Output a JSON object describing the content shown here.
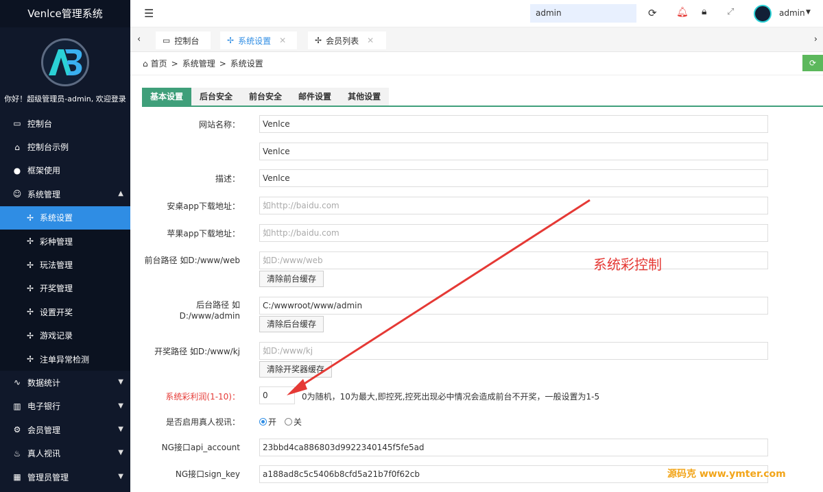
{
  "sidebar": {
    "title": "Venlce管理系统",
    "welcome": "你好！超级管理员-admin, 欢迎登录",
    "items": [
      {
        "label": "控制台",
        "icon": "monitor-icon"
      },
      {
        "label": "控制台示例",
        "icon": "home-icon"
      },
      {
        "label": "框架使用",
        "icon": "ok-icon"
      },
      {
        "label": "系统管理",
        "icon": "user-icon"
      },
      {
        "label": "系统设置",
        "icon": "fan-icon"
      },
      {
        "label": "彩种管理",
        "icon": "fan-icon"
      },
      {
        "label": "玩法管理",
        "icon": "fan-icon"
      },
      {
        "label": "开奖管理",
        "icon": "fan-icon"
      },
      {
        "label": "设置开奖",
        "icon": "fan-icon"
      },
      {
        "label": "游戏记录",
        "icon": "fan-icon"
      },
      {
        "label": "注单异常检测",
        "icon": "fan-icon"
      },
      {
        "label": "数据统计",
        "icon": "chart-icon"
      },
      {
        "label": "电子银行",
        "icon": "bank-icon"
      },
      {
        "label": "会员管理",
        "icon": "gear-icon"
      },
      {
        "label": "真人视讯",
        "icon": "fire-icon"
      },
      {
        "label": "管理员管理",
        "icon": "grid-icon"
      }
    ]
  },
  "topbar": {
    "search_value": "admin",
    "user_name": "admin"
  },
  "tabs": [
    {
      "label": "控制台",
      "icon": "monitor-icon"
    },
    {
      "label": "系统设置",
      "icon": "fan-icon",
      "active": true
    },
    {
      "label": "会员列表",
      "icon": "fan-icon"
    }
  ],
  "breadcrumb": [
    "首页",
    "系统管理",
    "系统设置"
  ],
  "settings_tabs": [
    "基本设置",
    "后台安全",
    "前台安全",
    "邮件设置",
    "其他设置"
  ],
  "form": {
    "site_name_label": "网站名称：",
    "site_name_value": "Venlce",
    "row2_value": "Venlce",
    "desc_label": "描述：",
    "desc_value": "Venlce",
    "android_label": "安桌app下载地址：",
    "android_placeholder": "如http://baidu.com",
    "apple_label": "苹果app下载地址：",
    "apple_placeholder": "如http://baidu.com",
    "front_path_label": "前台路径 如D:/www/web",
    "front_path_placeholder": "如D:/www/web",
    "clear_front_btn": "清除前台缓存",
    "back_path_label": "后台路径 如D:/www/admin",
    "back_path_value": "C:/wwwroot/www/admin",
    "clear_back_btn": "清除后台缓存",
    "draw_path_label": "开奖路径 如D:/www/kj",
    "draw_path_placeholder": "如D:/www/kj",
    "clear_draw_btn": "清除开奖器缓存",
    "profit_label": "系统彩利润(1-10)：",
    "profit_value": "0",
    "profit_note": "0为随机，10为最大,即控死,控死出现必中情况会造成前台不开奖，一般设置为1-5",
    "live_label": "是否启用真人视讯：",
    "live_on": "开",
    "live_off": "关",
    "ng_account_label": "NG接口api_account",
    "ng_account_value": "23bbd4ca886803d9922340145f5fe5ad",
    "ng_key_label": "NG接口sign_key",
    "ng_key_value": "a188ad8c5c5406b8cfd5a21b7f0f62cb"
  },
  "annotation": "系统彩控制",
  "watermark": "源码克  www.ymter.com",
  "colors": {
    "sidebar": "#10182a",
    "active": "#2f8de4",
    "tab_green": "#3f9f7a",
    "annotation": "#e53935"
  }
}
